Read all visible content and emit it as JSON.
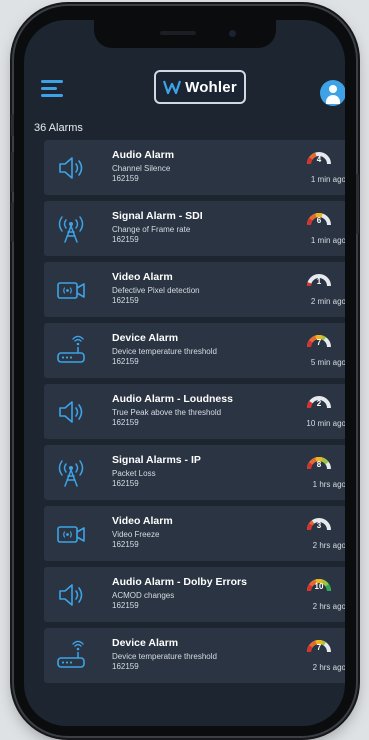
{
  "header": {
    "logo_text": "Wohler"
  },
  "alarm_count": "36 Alarms",
  "colors": {
    "accent": "#3da3e6",
    "card_bg": "#2b3442",
    "screen_bg": "#1d2530"
  },
  "alarms": [
    {
      "title": "Audio Alarm",
      "description": "Channel Silence",
      "code": "162159",
      "time": "1 min ago",
      "severity": "4",
      "icon": "speaker-icon",
      "gauge_level": 0.4
    },
    {
      "title": "Signal Alarm - SDI",
      "description": "Change of Frame rate",
      "code": "162159",
      "time": "1 min ago",
      "severity": "6",
      "icon": "signal-tower-icon",
      "gauge_level": 0.6
    },
    {
      "title": "Video Alarm",
      "description": "Defective Pixel detection",
      "code": "162159",
      "time": "2 min ago",
      "severity": "1",
      "icon": "video-camera-icon",
      "gauge_level": 0.1
    },
    {
      "title": "Device Alarm",
      "description": "Device temperature threshold",
      "code": "162159",
      "time": "5 min ago",
      "severity": "7",
      "icon": "router-icon",
      "gauge_level": 0.7
    },
    {
      "title": "Audio Alarm - Loudness",
      "description": "True Peak above the threshold",
      "code": "162159",
      "time": "10 min ago",
      "severity": "2",
      "icon": "speaker-icon",
      "gauge_level": 0.2
    },
    {
      "title": "Signal Alarms - IP",
      "description": "Packet Loss",
      "code": "162159",
      "time": "1 hrs ago",
      "severity": "8",
      "icon": "signal-tower-icon",
      "gauge_level": 0.8
    },
    {
      "title": "Video Alarm",
      "description": "Video Freeze",
      "code": "162159",
      "time": "2 hrs ago",
      "severity": "3",
      "icon": "video-camera-icon",
      "gauge_level": 0.3
    },
    {
      "title": "Audio Alarm - Dolby Errors",
      "description": "ACMOD changes",
      "code": "162159",
      "time": "2 hrs ago",
      "severity": "10",
      "icon": "speaker-icon",
      "gauge_level": 1.0
    },
    {
      "title": "Device Alarm",
      "description": "Device temperature threshold",
      "code": "162159",
      "time": "2 hrs ago",
      "severity": "7",
      "icon": "router-icon",
      "gauge_level": 0.7
    }
  ]
}
